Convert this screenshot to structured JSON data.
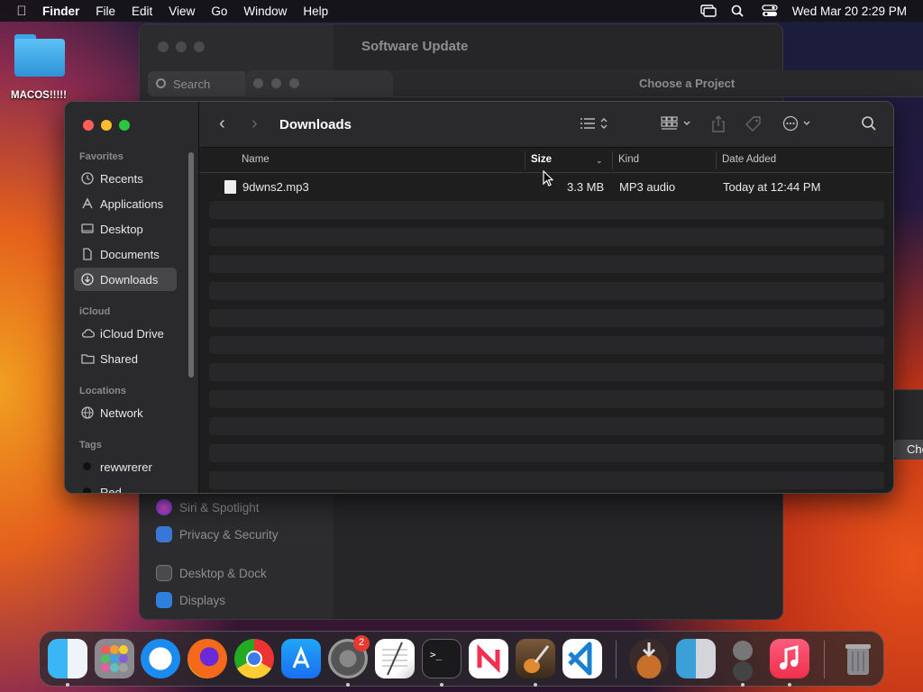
{
  "menubar": {
    "app": "Finder",
    "items": [
      "File",
      "Edit",
      "View",
      "Go",
      "Window",
      "Help"
    ],
    "clock": "Wed Mar 20  2:29 PM"
  },
  "desktop": {
    "folder_label": "MACOS!!!!!"
  },
  "system_settings": {
    "title": "Software Update",
    "search_placeholder": "Search",
    "items": [
      {
        "label": "Siri & Spotlight",
        "color": "#b44ad6"
      },
      {
        "label": "Privacy & Security",
        "color": "#3a78d8"
      },
      {
        "label": "Desktop & Dock",
        "color": "#3a3a3c"
      },
      {
        "label": "Displays",
        "color": "#2f7fe0"
      }
    ]
  },
  "choose_project": {
    "title": "Choose a Project",
    "button": "Che"
  },
  "finder": {
    "title": "Downloads",
    "sidebar": {
      "favorites_header": "Favorites",
      "favorites": [
        "Recents",
        "Applications",
        "Desktop",
        "Documents",
        "Downloads"
      ],
      "icloud_header": "iCloud",
      "icloud": [
        "iCloud Drive",
        "Shared"
      ],
      "locations_header": "Locations",
      "locations": [
        "Network"
      ],
      "tags_header": "Tags",
      "tags": [
        "rewwrerer",
        "Red"
      ]
    },
    "columns": {
      "name": "Name",
      "size": "Size",
      "kind": "Kind",
      "date": "Date Added"
    },
    "files": [
      {
        "name": "9dwns2.mp3",
        "size": "3.3 MB",
        "kind": "MP3 audio",
        "date": "Today at 12:44 PM"
      }
    ]
  },
  "dock": {
    "badge_settings": "2"
  }
}
